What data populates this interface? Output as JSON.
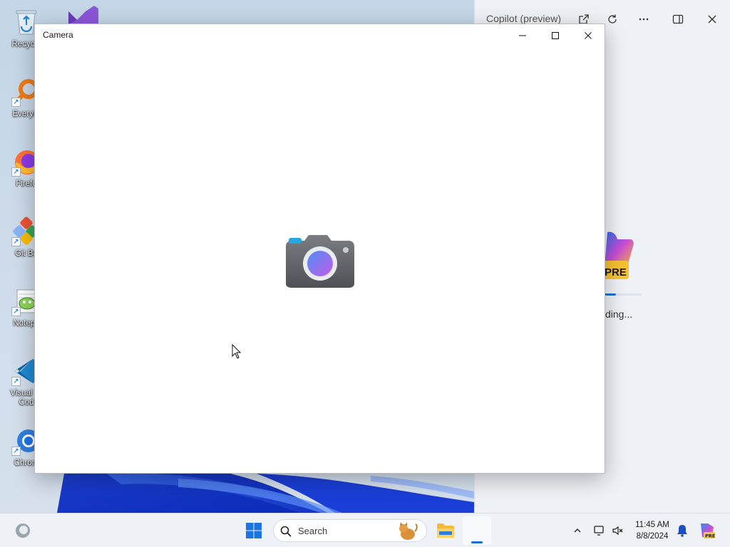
{
  "desktop": {
    "icons": [
      {
        "label": "Recycle",
        "icon": "recycle-bin-icon"
      },
      {
        "label": "Everyth",
        "icon": "everything-search-icon"
      },
      {
        "label": "Firefo",
        "icon": "firefox-icon"
      },
      {
        "label": "Git Ba",
        "icon": "git-bash-icon"
      },
      {
        "label": "Notepa",
        "icon": "notepad-plus-plus-icon"
      },
      {
        "label": "Visual St\nCod",
        "icon": "vscode-icon"
      },
      {
        "label": "Chrom",
        "icon": "chrome-icon"
      }
    ]
  },
  "copilot": {
    "title": "Copilot (preview)",
    "loading_text": "ding...",
    "badge": "PRE",
    "progress": 0.3,
    "buttons": [
      "open-in-new-icon",
      "refresh-icon",
      "more-icon",
      "split-view-icon",
      "close-icon"
    ]
  },
  "camera_window": {
    "title": "Camera",
    "controls": [
      "minimize-icon",
      "maximize-icon",
      "close-icon"
    ]
  },
  "taskbar": {
    "search_placeholder": "Search",
    "time": "11:45 AM",
    "date": "8/8/2024",
    "accent": "#1a6dd0"
  }
}
